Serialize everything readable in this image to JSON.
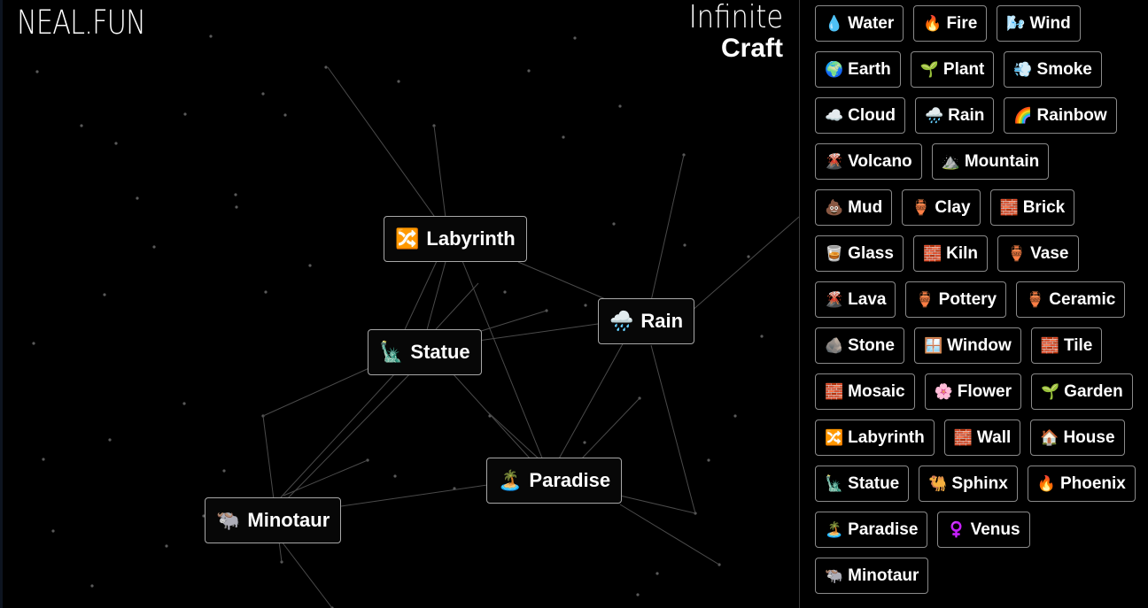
{
  "header": {
    "logo": "NEAL.FUN",
    "title_line1": "Infinite",
    "title_line2": "Craft"
  },
  "canvas": {
    "nodes": [
      {
        "id": "labyrinth",
        "emoji": "🔀",
        "label": "Labyrinth"
      },
      {
        "id": "rain",
        "emoji": "🌧️",
        "label": "Rain"
      },
      {
        "id": "statue",
        "emoji": "🗽",
        "label": "Statue"
      },
      {
        "id": "paradise",
        "emoji": "🏝️",
        "label": "Paradise"
      },
      {
        "id": "minotaur",
        "emoji": "🐃",
        "label": "Minotaur"
      }
    ]
  },
  "sidebar": {
    "items": [
      {
        "emoji": "💧",
        "label": "Water"
      },
      {
        "emoji": "🔥",
        "label": "Fire"
      },
      {
        "emoji": "🌬️",
        "label": "Wind"
      },
      {
        "emoji": "🌍",
        "label": "Earth"
      },
      {
        "emoji": "🌱",
        "label": "Plant"
      },
      {
        "emoji": "💨",
        "label": "Smoke"
      },
      {
        "emoji": "☁️",
        "label": "Cloud"
      },
      {
        "emoji": "🌧️",
        "label": "Rain"
      },
      {
        "emoji": "🌈",
        "label": "Rainbow"
      },
      {
        "emoji": "🌋",
        "label": "Volcano"
      },
      {
        "emoji": "⛰️",
        "label": "Mountain"
      },
      {
        "emoji": "💩",
        "label": "Mud"
      },
      {
        "emoji": "🏺",
        "label": "Clay"
      },
      {
        "emoji": "🧱",
        "label": "Brick"
      },
      {
        "emoji": "🥃",
        "label": "Glass"
      },
      {
        "emoji": "🧱",
        "label": "Kiln"
      },
      {
        "emoji": "🏺",
        "label": "Vase"
      },
      {
        "emoji": "🌋",
        "label": "Lava"
      },
      {
        "emoji": "🏺",
        "label": "Pottery"
      },
      {
        "emoji": "🏺",
        "label": "Ceramic"
      },
      {
        "emoji": "🪨",
        "label": "Stone"
      },
      {
        "emoji": "🪟",
        "label": "Window"
      },
      {
        "emoji": "🧱",
        "label": "Tile"
      },
      {
        "emoji": "🧱",
        "label": "Mosaic"
      },
      {
        "emoji": "🌸",
        "label": "Flower"
      },
      {
        "emoji": "🌱",
        "label": "Garden"
      },
      {
        "emoji": "🔀",
        "label": "Labyrinth"
      },
      {
        "emoji": "🧱",
        "label": "Wall"
      },
      {
        "emoji": "🏠",
        "label": "House"
      },
      {
        "emoji": "🗽",
        "label": "Statue"
      },
      {
        "emoji": "🐫",
        "label": "Sphinx"
      },
      {
        "emoji": "🔥",
        "label": "Phoenix"
      },
      {
        "emoji": "🏝️",
        "label": "Paradise"
      },
      {
        "emoji": "♀️",
        "label": "Venus"
      },
      {
        "emoji": "🐃",
        "label": "Minotaur"
      }
    ]
  }
}
